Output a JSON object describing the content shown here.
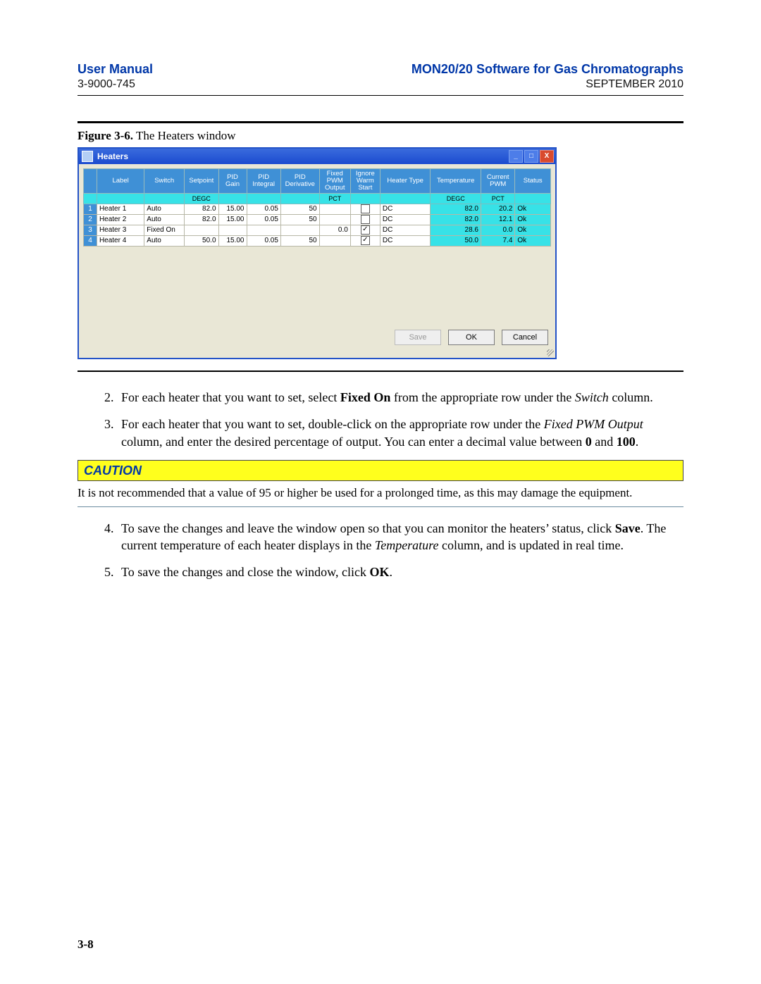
{
  "header": {
    "left": "User Manual",
    "right": "MON20/20 Software for Gas Chromatographs",
    "sub_left": "3-9000-745",
    "sub_right": "SEPTEMBER 2010"
  },
  "figure_caption_label": "Figure 3-6.",
  "figure_caption_text": "  The Heaters window",
  "dialog": {
    "title": "Heaters",
    "buttons": {
      "save": "Save",
      "ok": "OK",
      "cancel": "Cancel"
    },
    "win": {
      "min": "_",
      "max": "□",
      "close": "X"
    },
    "columns": [
      "",
      "Label",
      "Switch",
      "Setpoint",
      "PID\nGain",
      "PID\nIntegral",
      "PID\nDerivative",
      "Fixed\nPWM\nOutput",
      "Ignore\nWarm\nStart",
      "Heater Type",
      "Temperature",
      "Current\nPWM",
      "Status"
    ],
    "units": [
      "",
      "",
      "",
      "DEGC",
      "",
      "",
      "",
      "PCT",
      "",
      "",
      "DEGC",
      "PCT",
      ""
    ],
    "rows": [
      {
        "n": "1",
        "label": "Heater 1",
        "switch": "Auto",
        "setpoint": "82.0",
        "gain": "15.00",
        "integral": "0.05",
        "deriv": "50",
        "fpwm": "",
        "ignore": false,
        "type": "DC",
        "temp": "82.0",
        "cpwm": "20.2",
        "status": "Ok"
      },
      {
        "n": "2",
        "label": "Heater 2",
        "switch": "Auto",
        "setpoint": "82.0",
        "gain": "15.00",
        "integral": "0.05",
        "deriv": "50",
        "fpwm": "",
        "ignore": false,
        "type": "DC",
        "temp": "82.0",
        "cpwm": "12.1",
        "status": "Ok"
      },
      {
        "n": "3",
        "label": "Heater 3",
        "switch": "Fixed On",
        "setpoint": "",
        "gain": "",
        "integral": "",
        "deriv": "",
        "fpwm": "0.0",
        "ignore": true,
        "type": "DC",
        "temp": "28.6",
        "cpwm": "0.0",
        "status": "Ok"
      },
      {
        "n": "4",
        "label": "Heater 4",
        "switch": "Auto",
        "setpoint": "50.0",
        "gain": "15.00",
        "integral": "0.05",
        "deriv": "50",
        "fpwm": "",
        "ignore": true,
        "type": "DC",
        "temp": "50.0",
        "cpwm": "7.4",
        "status": "Ok"
      }
    ]
  },
  "steps": {
    "s2_a": "For each heater that you want to set, select ",
    "s2_b": "Fixed On",
    "s2_c": " from the appropriate row under the ",
    "s2_d": "Switch",
    "s2_e": " column.",
    "s3_a": "For each heater that you want to set, double-click on the appropriate row under the ",
    "s3_b": "Fixed PWM Output",
    "s3_c": " column, and enter the desired percentage of output.  You can enter a decimal value between ",
    "s3_d": "0",
    "s3_e": " and ",
    "s3_f": "100",
    "s3_g": ".",
    "s4_a": "To save the changes and leave the window open so that you can monitor the heaters’ status, click ",
    "s4_b": "Save",
    "s4_c": ". The current temperature of each heater displays in the ",
    "s4_d": "Temperature",
    "s4_e": " column, and is updated in real time.",
    "s5_a": "To save the changes and close the window, click ",
    "s5_b": "OK",
    "s5_c": "."
  },
  "caution": {
    "label": "CAUTION",
    "text": "It is not recommended that a value of 95 or higher be used for a prolonged time, as this may damage the equipment."
  },
  "page_number": "3-8"
}
